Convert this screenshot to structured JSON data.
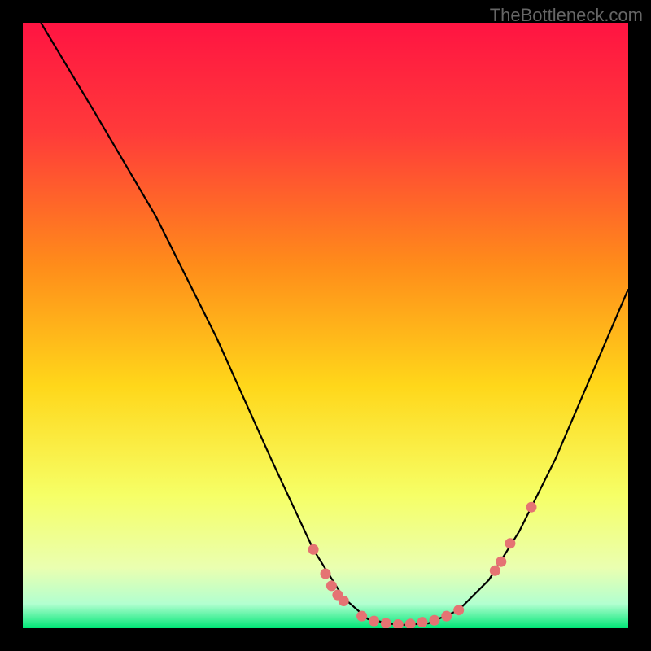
{
  "watermark": "TheBottleneck.com",
  "chart_data": {
    "type": "line",
    "title": "",
    "xlabel": "",
    "ylabel": "",
    "xlim": [
      0,
      100
    ],
    "ylim": [
      0,
      100
    ],
    "gradient_colors": {
      "top": "#ff1744",
      "mid1": "#ff9800",
      "mid2": "#ffeb3b",
      "low": "#f9ffb0",
      "bottom": "#00e676"
    },
    "series": [
      {
        "name": "curve",
        "type": "line",
        "points": [
          {
            "x": 3.0,
            "y": 100.0
          },
          {
            "x": 12.0,
            "y": 85.0
          },
          {
            "x": 22.0,
            "y": 68.0
          },
          {
            "x": 32.0,
            "y": 48.0
          },
          {
            "x": 41.0,
            "y": 28.0
          },
          {
            "x": 48.0,
            "y": 13.0
          },
          {
            "x": 53.0,
            "y": 5.0
          },
          {
            "x": 57.0,
            "y": 1.5
          },
          {
            "x": 62.0,
            "y": 0.5
          },
          {
            "x": 67.0,
            "y": 0.8
          },
          {
            "x": 72.0,
            "y": 3.0
          },
          {
            "x": 77.0,
            "y": 8.0
          },
          {
            "x": 82.0,
            "y": 16.0
          },
          {
            "x": 88.0,
            "y": 28.0
          },
          {
            "x": 94.0,
            "y": 42.0
          },
          {
            "x": 100.0,
            "y": 56.0
          }
        ]
      },
      {
        "name": "markers",
        "type": "scatter",
        "color": "#e57373",
        "points": [
          {
            "x": 48.0,
            "y": 13.0
          },
          {
            "x": 50.0,
            "y": 9.0
          },
          {
            "x": 51.0,
            "y": 7.0
          },
          {
            "x": 52.0,
            "y": 5.5
          },
          {
            "x": 53.0,
            "y": 4.5
          },
          {
            "x": 56.0,
            "y": 2.0
          },
          {
            "x": 58.0,
            "y": 1.2
          },
          {
            "x": 60.0,
            "y": 0.8
          },
          {
            "x": 62.0,
            "y": 0.6
          },
          {
            "x": 64.0,
            "y": 0.7
          },
          {
            "x": 66.0,
            "y": 1.0
          },
          {
            "x": 68.0,
            "y": 1.3
          },
          {
            "x": 70.0,
            "y": 2.0
          },
          {
            "x": 72.0,
            "y": 3.0
          },
          {
            "x": 78.0,
            "y": 9.5
          },
          {
            "x": 79.0,
            "y": 11.0
          },
          {
            "x": 80.5,
            "y": 14.0
          },
          {
            "x": 84.0,
            "y": 20.0
          }
        ]
      }
    ]
  }
}
